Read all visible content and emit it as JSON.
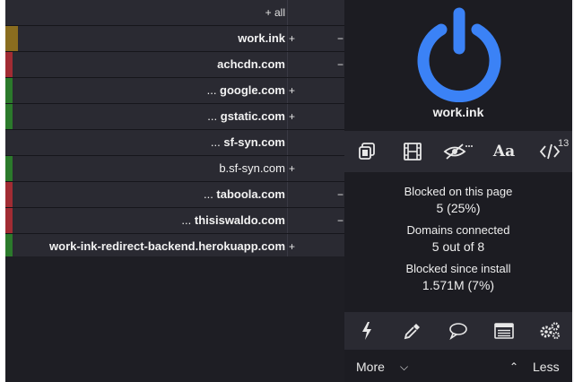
{
  "firewall": {
    "all_label": "+ all",
    "rows": [
      {
        "prefix": "",
        "domain": "work.ink",
        "plus": "+",
        "minus": "−",
        "color": "#8a6d1f",
        "wide": true,
        "bold": true
      },
      {
        "prefix": "",
        "domain": "achcdn.com",
        "plus": "",
        "minus": "−",
        "color": "#a12c33",
        "wide": false,
        "bold": true
      },
      {
        "prefix": "... ",
        "domain": "google.com",
        "plus": "+",
        "minus": "",
        "color": "#2b7a2b",
        "wide": false,
        "bold": true
      },
      {
        "prefix": "... ",
        "domain": "gstatic.com",
        "plus": "+",
        "minus": "",
        "color": "#2b7a2b",
        "wide": false,
        "bold": true
      },
      {
        "prefix": "... ",
        "domain": "sf-syn.com",
        "plus": "",
        "minus": "",
        "color": "",
        "wide": false,
        "bold": true
      },
      {
        "prefix": "",
        "domain": "b.sf-syn.com",
        "plus": "+",
        "minus": "",
        "color": "#2b7a2b",
        "wide": false,
        "bold": false
      },
      {
        "prefix": "... ",
        "domain": "taboola.com",
        "plus": "",
        "minus": "−",
        "color": "#a12c33",
        "wide": false,
        "bold": true
      },
      {
        "prefix": "... ",
        "domain": "thisiswaldo.com",
        "plus": "",
        "minus": "−",
        "color": "#a12c33",
        "wide": false,
        "bold": true
      },
      {
        "prefix": "",
        "domain": "work-ink-redirect-backend.herokuapp.com",
        "plus": "+",
        "minus": "",
        "color": "#2b7a2b",
        "wide": false,
        "bold": true
      }
    ]
  },
  "main": {
    "hostname": "work.ink",
    "power_color": "#3b82f6",
    "tools": [
      "element-picker-icon",
      "media-icon",
      "cosmetic-filter-icon",
      "fonts-icon",
      "scripts-icon"
    ],
    "fonts_label": "Aa",
    "scripts_badge": "13",
    "stats": {
      "blocked_page_label": "Blocked on this page",
      "blocked_page_value": "5 (25%)",
      "domains_label": "Domains connected",
      "domains_value": "5 out of 8",
      "blocked_install_label": "Blocked since install",
      "blocked_install_value": "1.571M (7%)"
    },
    "bottom_tools": [
      "lightning-icon",
      "eyedropper-icon",
      "chat-bubble-icon",
      "logger-icon",
      "settings-icon"
    ],
    "more_label": "More",
    "less_label": "Less"
  }
}
